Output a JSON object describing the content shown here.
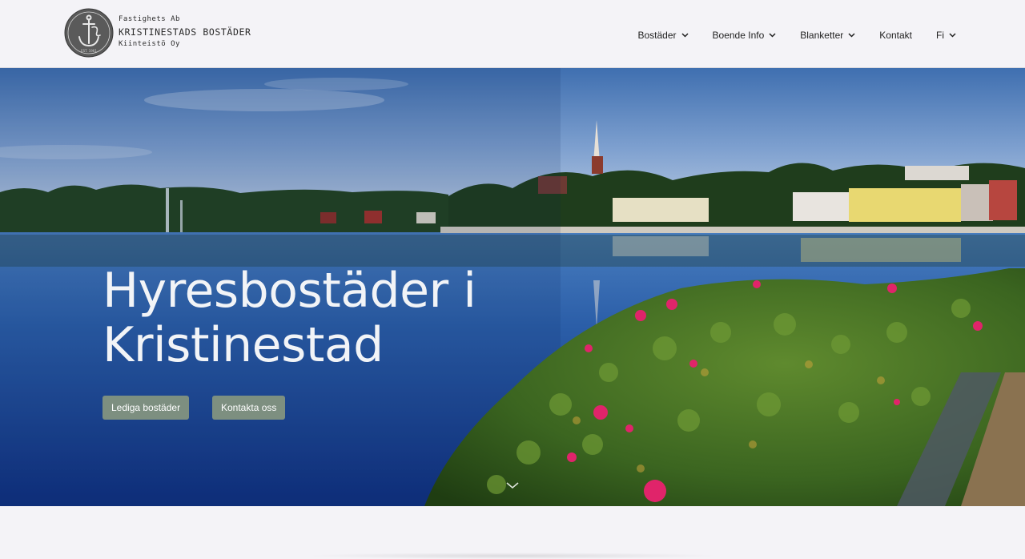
{
  "brand": {
    "line1": "Fastighets Ab",
    "line2": "KRISTINESTADS BOSTÄDER",
    "line3": "Kiinteistö Oy",
    "emblem_text": "EST. 1961"
  },
  "nav": {
    "items": [
      {
        "label": "Bostäder",
        "has_dropdown": true
      },
      {
        "label": "Boende Info",
        "has_dropdown": true
      },
      {
        "label": "Blanketter",
        "has_dropdown": true
      },
      {
        "label": "Kontakt",
        "has_dropdown": false
      },
      {
        "label": "Fi",
        "has_dropdown": true
      }
    ]
  },
  "hero": {
    "title_line1": "Hyresbostäder i",
    "title_line2": "Kristinestad",
    "primary_button": "Lediga bostäder",
    "secondary_button": "Kontakta oss",
    "scroll_icon": "chevron-down-icon"
  },
  "colors": {
    "header_bg": "#f4f3f7",
    "button_bg": "#7d8f80",
    "title_text": "#f2f4f7"
  }
}
